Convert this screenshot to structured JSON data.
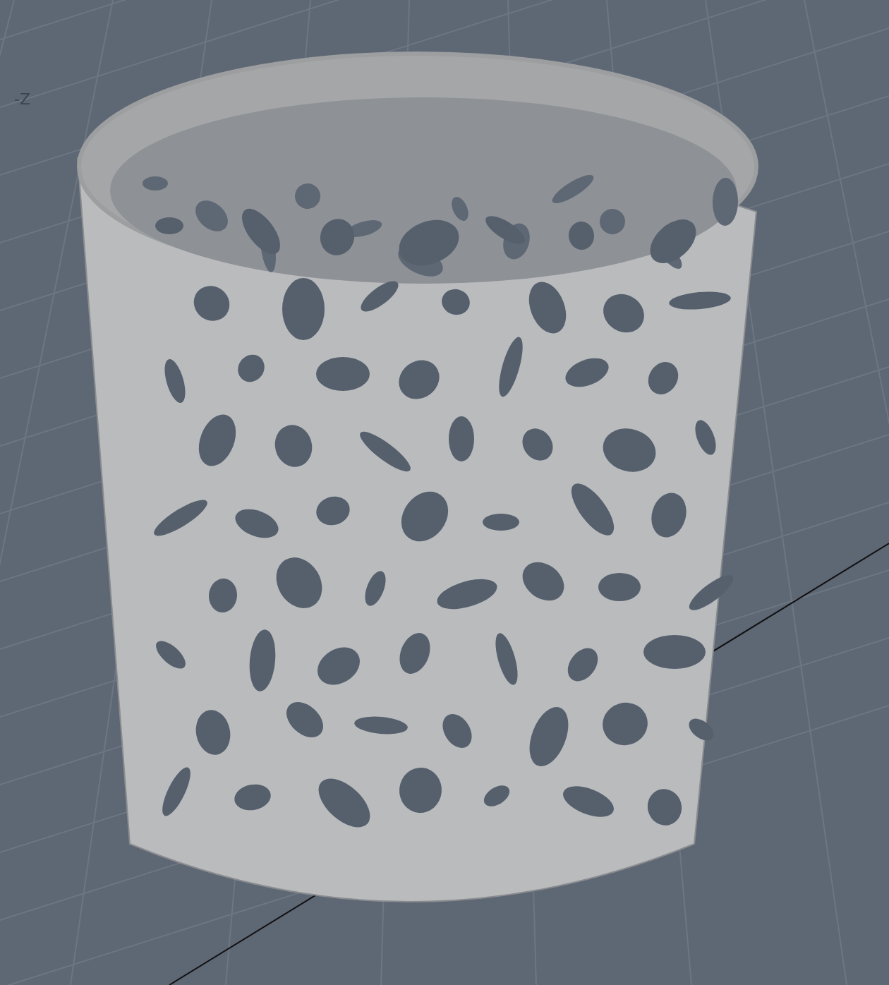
{
  "viewport": {
    "axis_label": "-Z"
  }
}
